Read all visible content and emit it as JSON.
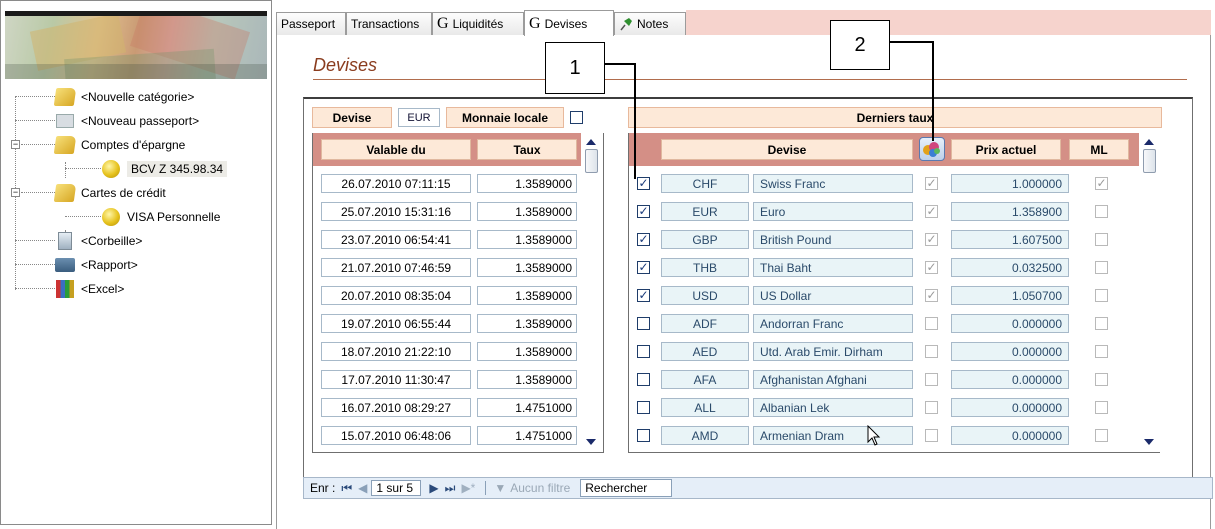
{
  "nav": {
    "items": [
      {
        "label": "<Nouvelle catégorie>",
        "icon": "folder-add-icon"
      },
      {
        "label": "<Nouveau passeport>",
        "icon": "document-icon"
      },
      {
        "label": "Comptes d'épargne",
        "icon": "folder-icon"
      },
      {
        "label": "BCV Z 345.98.34",
        "icon": "coin-icon"
      },
      {
        "label": "Cartes de crédit",
        "icon": "folder-icon"
      },
      {
        "label": "VISA Personnelle",
        "icon": "coin-icon"
      },
      {
        "label": "<Corbeille>",
        "icon": "trash-icon"
      },
      {
        "label": "<Rapport>",
        "icon": "printer-icon"
      },
      {
        "label": "<Excel>",
        "icon": "excel-icon"
      }
    ]
  },
  "tabs": [
    {
      "label": "Passeport"
    },
    {
      "label": "Transactions"
    },
    {
      "label": "Liquidités",
      "glyph": "G"
    },
    {
      "label": "Devises",
      "glyph": "G"
    },
    {
      "label": "Notes"
    }
  ],
  "page": {
    "title": "Devises",
    "devise_label": "Devise",
    "devise_value": "EUR",
    "monnaie_locale_label": "Monnaie locale",
    "derniers_taux_label": "Derniers taux"
  },
  "left_grid": {
    "headers": [
      "Valable du",
      "Taux"
    ],
    "rows": [
      [
        "26.07.2010 07:11:15",
        "1.3589000"
      ],
      [
        "25.07.2010 15:31:16",
        "1.3589000"
      ],
      [
        "23.07.2010 06:54:41",
        "1.3589000"
      ],
      [
        "21.07.2010 07:46:59",
        "1.3589000"
      ],
      [
        "20.07.2010 08:35:04",
        "1.3589000"
      ],
      [
        "19.07.2010 06:55:44",
        "1.3589000"
      ],
      [
        "18.07.2010 21:22:10",
        "1.3589000"
      ],
      [
        "17.07.2010 11:30:47",
        "1.3589000"
      ],
      [
        "16.07.2010 08:29:27",
        "1.4751000"
      ],
      [
        "15.07.2010 06:48:06",
        "1.4751000"
      ]
    ]
  },
  "right_grid": {
    "headers": [
      "Devise",
      "Prix actuel",
      "ML"
    ],
    "rows": [
      {
        "sel": true,
        "code": "CHF",
        "name": "Swiss Franc",
        "flag": true,
        "price": "1.000000",
        "ml": true
      },
      {
        "sel": true,
        "code": "EUR",
        "name": "Euro",
        "flag": true,
        "price": "1.358900",
        "ml": false
      },
      {
        "sel": true,
        "code": "GBP",
        "name": "British Pound",
        "flag": true,
        "price": "1.607500",
        "ml": false
      },
      {
        "sel": true,
        "code": "THB",
        "name": "Thai Baht",
        "flag": true,
        "price": "0.032500",
        "ml": false
      },
      {
        "sel": true,
        "code": "USD",
        "name": "US Dollar",
        "flag": true,
        "price": "1.050700",
        "ml": false
      },
      {
        "sel": false,
        "code": "ADF",
        "name": "Andorran Franc",
        "flag": false,
        "price": "0.000000",
        "ml": false
      },
      {
        "sel": false,
        "code": "AED",
        "name": "Utd. Arab Emir. Dirham",
        "flag": false,
        "price": "0.000000",
        "ml": false
      },
      {
        "sel": false,
        "code": "AFA",
        "name": "Afghanistan Afghani",
        "flag": false,
        "price": "0.000000",
        "ml": false
      },
      {
        "sel": false,
        "code": "ALL",
        "name": "Albanian Lek",
        "flag": false,
        "price": "0.000000",
        "ml": false
      },
      {
        "sel": false,
        "code": "AMD",
        "name": "Armenian Dram",
        "flag": false,
        "price": "0.000000",
        "ml": false
      }
    ]
  },
  "navbar": {
    "record_label": "Enr :",
    "record_value": "1 sur 5",
    "filter_label": "Aucun filtre",
    "search_label": "Rechercher"
  },
  "callouts": [
    "1",
    "2"
  ],
  "colors": {
    "title": "#8a3c1e",
    "grid_header_bar": "#d48f86",
    "header_pill": "#fde9d8",
    "tab_fill": "#f6d3cd",
    "cell_tint": "#e9f4f7"
  }
}
